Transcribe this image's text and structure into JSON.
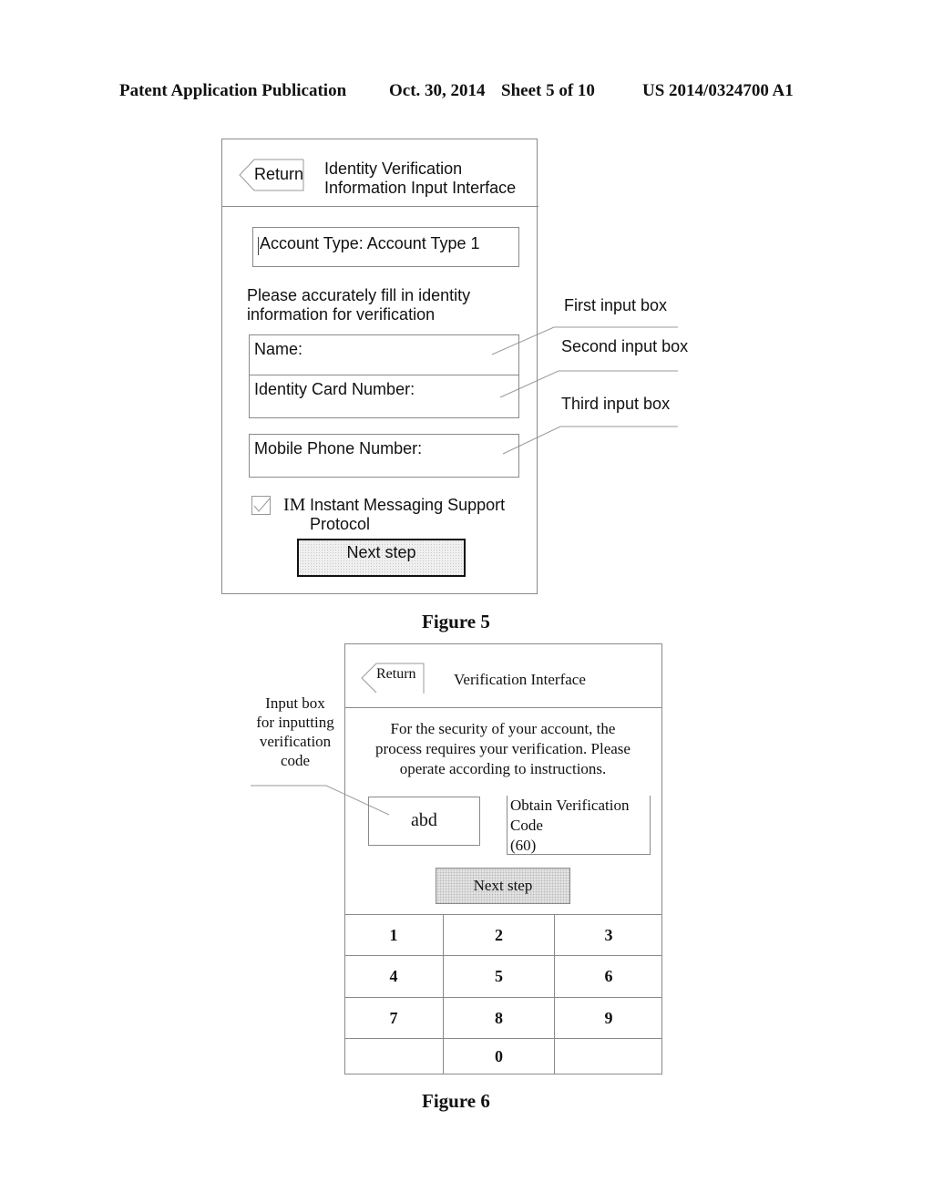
{
  "header": {
    "publication": "Patent Application Publication",
    "date": "Oct. 30, 2014",
    "sheet": "Sheet 5 of 10",
    "number": "US 2014/0324700 A1"
  },
  "figure5": {
    "return_label": "Return",
    "title_line1": "Identity Verification",
    "title_line2": "Information Input Interface",
    "account_type": "Account Type: Account Type 1",
    "instruction_line1": "Please accurately fill in identity",
    "instruction_line2": "information for verification",
    "fields": {
      "name": "Name:",
      "id_card": "Identity Card Number:",
      "mobile": "Mobile Phone Number:"
    },
    "callouts": {
      "first": "First input box",
      "second": "Second input box",
      "third": "Third input box"
    },
    "protocol_checked": true,
    "protocol_prefix": "IM",
    "protocol_line1": "Instant Messaging Support",
    "protocol_line2": "Protocol",
    "next_label": "Next step",
    "caption": "Figure 5"
  },
  "figure6": {
    "return_label": "Return",
    "title": "Verification Interface",
    "security_line1": "For the security of your account, the",
    "security_line2": "process requires your verification.  Please",
    "security_line3": "operate according to instructions.",
    "code_value": "abd",
    "obtain_line1": "Obtain Verification",
    "obtain_line2": "Code",
    "obtain_countdown": "(60)",
    "next_label": "Next step",
    "keypad": [
      "1",
      "2",
      "3",
      "4",
      "5",
      "6",
      "7",
      "8",
      "9",
      "",
      "0",
      ""
    ],
    "annotation_line1": "Input box",
    "annotation_line2": "for inputting",
    "annotation_line3": "verification",
    "annotation_line4": "code",
    "caption": "Figure 6"
  }
}
